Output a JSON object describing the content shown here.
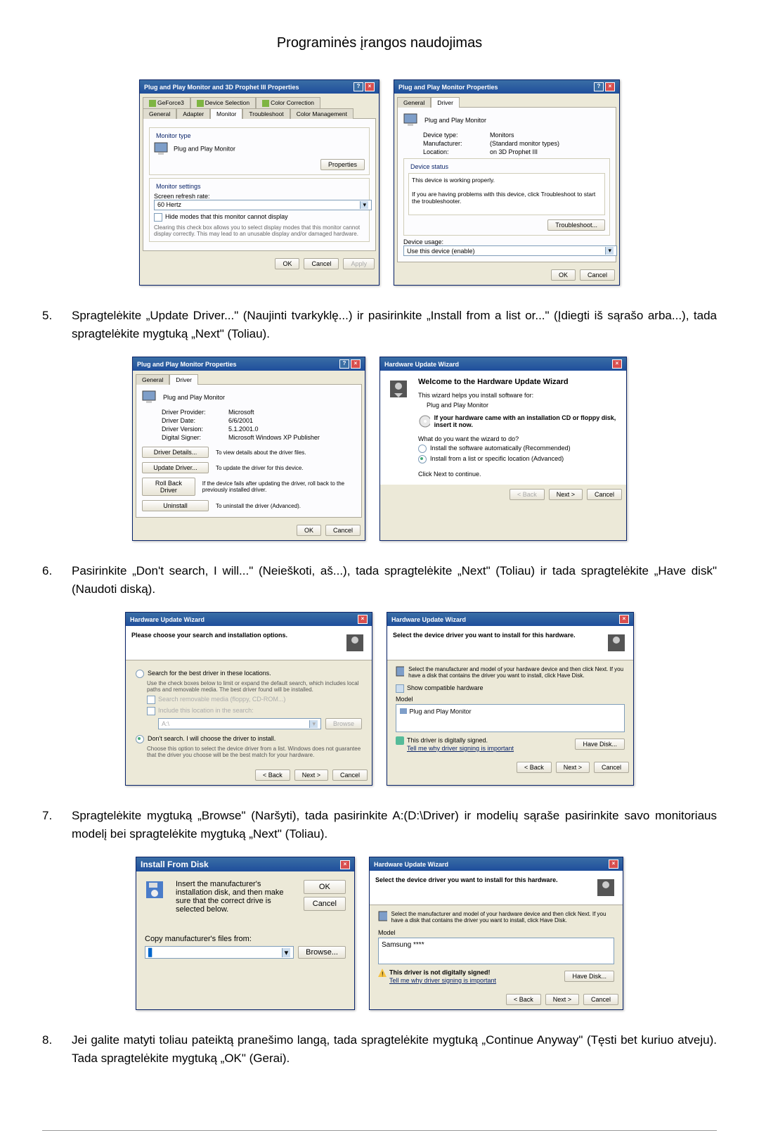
{
  "page_title": "Programinės įrangos naudojimas",
  "steps": {
    "s5": {
      "num": "5.",
      "text": "Spragtelėkite „Update Driver...\" (Naujinti tvarkyklę...) ir pasirinkite „Install from a list or...\" (Įdiegti iš sąrašo arba...), tada spragtelėkite mygtuką „Next\" (Toliau)."
    },
    "s6": {
      "num": "6.",
      "text": "Pasirinkite „Don't search, I will...\" (Neieškoti, aš...), tada spragtelėkite „Next\" (Toliau) ir tada spragtelėkite „Have disk\" (Naudoti diską)."
    },
    "s7": {
      "num": "7.",
      "text": "Spragtelėkite mygtuką „Browse\" (Naršyti), tada pasirinkite A:(D:\\Driver) ir modelių sąraše pasirinkite savo monitoriaus modelį bei spragtelėkite mygtuką „Next\" (Toliau)."
    },
    "s8": {
      "num": "8.",
      "text": "Jei galite matyti toliau pateiktą pranešimo langą, tada spragtelėkite mygtuką „Continue Anyway\" (Tęsti bet kuriuo atveju). Tada spragtelėkite mygtuką „OK\" (Gerai)."
    }
  },
  "dlgA": {
    "title": "Plug and Play Monitor and 3D Prophet III Properties",
    "tabs": {
      "geforce": "GeForce3",
      "devsel": "Device Selection",
      "colorcorr": "Color Correction",
      "general": "General",
      "adapter": "Adapter",
      "monitor": "Monitor",
      "trouble": "Troubleshoot",
      "colorman": "Color Management"
    },
    "montype": "Monitor type",
    "monname": "Plug and Play Monitor",
    "propbtn": "Properties",
    "monset": "Monitor settings",
    "refresh": "Screen refresh rate:",
    "hz": "60 Hertz",
    "hide": "Hide modes that this monitor cannot display",
    "hidedesc": "Clearing this check box allows you to select display modes that this monitor cannot display correctly. This may lead to an unusable display and/or damaged hardware.",
    "ok": "OK",
    "cancel": "Cancel",
    "apply": "Apply"
  },
  "dlgB": {
    "title": "Plug and Play Monitor Properties",
    "tabs": {
      "general": "General",
      "driver": "Driver"
    },
    "name": "Plug and Play Monitor",
    "devtype": "Device type:",
    "devtypev": "Monitors",
    "manuf": "Manufacturer:",
    "manufv": "(Standard monitor types)",
    "loc": "Location:",
    "locv": "on 3D Prophet III",
    "status": "Device status",
    "statustxt": "This device is working properly.",
    "statushelp": "If you are having problems with this device, click Troubleshoot to start the troubleshooter.",
    "tshoot": "Troubleshoot...",
    "usage": "Device usage:",
    "usagev": "Use this device (enable)",
    "ok": "OK",
    "cancel": "Cancel"
  },
  "dlgC": {
    "title": "Plug and Play Monitor Properties",
    "tabs": {
      "general": "General",
      "driver": "Driver"
    },
    "name": "Plug and Play Monitor",
    "prov": "Driver Provider:",
    "provv": "Microsoft",
    "date": "Driver Date:",
    "datev": "6/6/2001",
    "ver": "Driver Version:",
    "verv": "5.1.2001.0",
    "sig": "Digital Signer:",
    "sigv": "Microsoft Windows XP Publisher",
    "details": "Driver Details...",
    "detailst": "To view details about the driver files.",
    "update": "Update Driver...",
    "updatet": "To update the driver for this device.",
    "rollback": "Roll Back Driver",
    "rollbackt": "If the device fails after updating the driver, roll back to the previously installed driver.",
    "uninst": "Uninstall",
    "uninstt": "To uninstall the driver (Advanced).",
    "ok": "OK",
    "cancel": "Cancel"
  },
  "dlgD": {
    "title": "Hardware Update Wizard",
    "welcome": "Welcome to the Hardware Update Wizard",
    "helps": "This wizard helps you install software for:",
    "dev": "Plug and Play Monitor",
    "cd": "If your hardware came with an installation CD or floppy disk, insert it now.",
    "what": "What do you want the wizard to do?",
    "opt1": "Install the software automatically (Recommended)",
    "opt2": "Install from a list or specific location (Advanced)",
    "next": "Click Next to continue.",
    "back": "< Back",
    "nextbtn": "Next >",
    "cancel": "Cancel"
  },
  "dlgE": {
    "title": "Hardware Update Wizard",
    "heading": "Please choose your search and installation options.",
    "opt1": "Search for the best driver in these locations.",
    "opt1d": "Use the check boxes below to limit or expand the default search, which includes local paths and removable media. The best driver found will be installed.",
    "chk1": "Search removable media (floppy, CD-ROM...)",
    "chk2": "Include this location in the search:",
    "path": "A:\\",
    "browse": "Browse",
    "opt2": "Don't search. I will choose the driver to install.",
    "opt2d": "Choose this option to select the device driver from a list. Windows does not guarantee that the driver you choose will be the best match for your hardware.",
    "back": "< Back",
    "next": "Next >",
    "cancel": "Cancel"
  },
  "dlgF": {
    "title": "Hardware Update Wizard",
    "heading": "Select the device driver you want to install for this hardware.",
    "desc": "Select the manufacturer and model of your hardware device and then click Next. If you have a disk that contains the driver you want to install, click Have Disk.",
    "compat": "Show compatible hardware",
    "model": "Model",
    "item": "Plug and Play Monitor",
    "signed": "This driver is digitally signed.",
    "tell": "Tell me why driver signing is important",
    "have": "Have Disk...",
    "back": "< Back",
    "next": "Next >",
    "cancel": "Cancel"
  },
  "dlgG": {
    "title": "Install From Disk",
    "desc": "Insert the manufacturer's installation disk, and then make sure that the correct drive is selected below.",
    "ok": "OK",
    "cancel": "Cancel",
    "copy": "Copy manufacturer's files from:",
    "browse": "Browse..."
  },
  "dlgH": {
    "title": "Hardware Update Wizard",
    "heading": "Select the device driver you want to install for this hardware.",
    "desc": "Select the manufacturer and model of your hardware device and then click Next. If you have a disk that contains the driver you want to install, click Have Disk.",
    "model": "Model",
    "item": "Samsung ****",
    "notsigned": "This driver is not digitally signed!",
    "tell": "Tell me why driver signing is important",
    "have": "Have Disk...",
    "back": "< Back",
    "next": "Next >",
    "cancel": "Cancel"
  }
}
